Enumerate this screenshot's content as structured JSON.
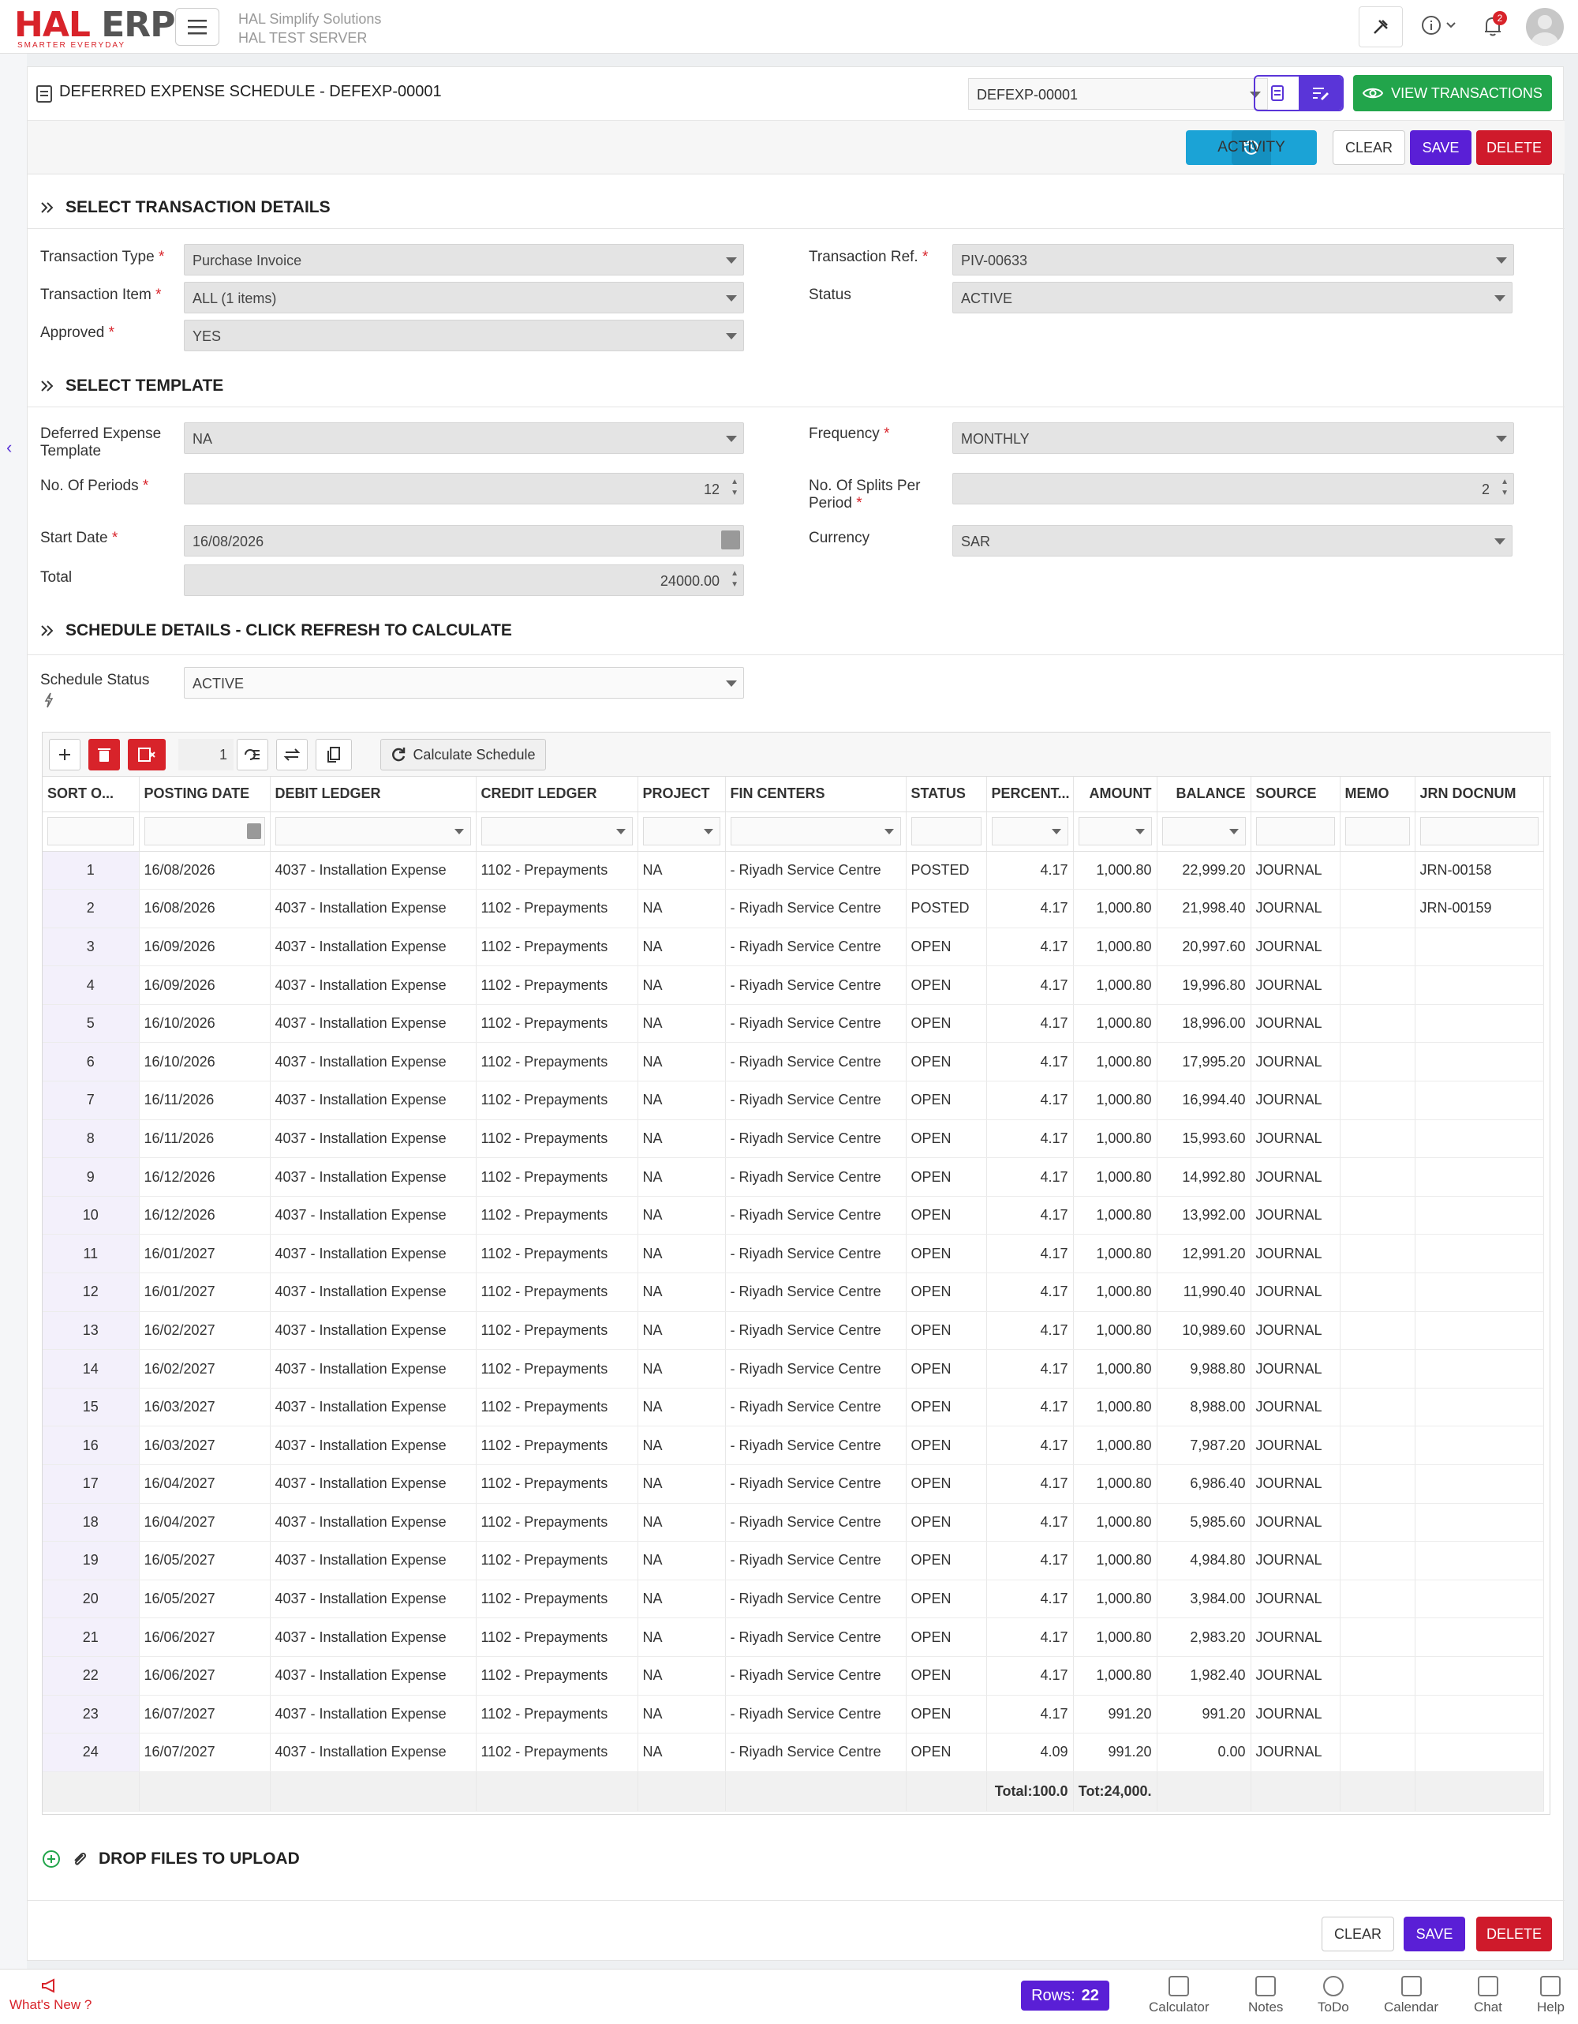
{
  "app": {
    "logo_hal": "HAL",
    "logo_erp": "ERP",
    "logo_tagline": "SMARTER EVERYDAY",
    "company_name": "HAL Simplify Solutions",
    "server_name": "HAL TEST SERVER",
    "notification_count": "2"
  },
  "header": {
    "title": "DEFERRED EXPENSE SCHEDULE - DEFEXP-00001",
    "doc_select_value": "DEFEXP-00001",
    "view_transactions_label": "VIEW TRANSACTIONS"
  },
  "actions": {
    "activity_label": "ACTIVITY",
    "clear_label": "CLEAR",
    "save_label": "SAVE",
    "delete_label": "DELETE"
  },
  "sections": {
    "transaction_details": "SELECT TRANSACTION DETAILS",
    "template": "SELECT TEMPLATE",
    "schedule_details": "SCHEDULE DETAILS - CLICK REFRESH TO CALCULATE",
    "upload": "DROP FILES TO UPLOAD"
  },
  "form": {
    "transaction_type": {
      "label": "Transaction Type",
      "value": "Purchase Invoice"
    },
    "transaction_item": {
      "label": "Transaction Item",
      "value": "ALL (1 items)"
    },
    "approved": {
      "label": "Approved",
      "value": "YES"
    },
    "transaction_ref": {
      "label": "Transaction Ref.",
      "value": "PIV-00633"
    },
    "status": {
      "label": "Status",
      "value": "ACTIVE"
    },
    "deferred_template": {
      "label": "Deferred Expense Template",
      "value": "NA"
    },
    "no_of_periods": {
      "label": "No. Of Periods",
      "value": "12"
    },
    "start_date": {
      "label": "Start Date",
      "value": "16/08/2026"
    },
    "total": {
      "label": "Total",
      "value": "24000.00"
    },
    "frequency": {
      "label": "Frequency",
      "value": "MONTHLY"
    },
    "splits_per_period": {
      "label": "No. Of Splits Per Period",
      "value": "2"
    },
    "currency": {
      "label": "Currency",
      "value": "SAR"
    },
    "schedule_status": {
      "label": "Schedule Status",
      "value": "ACTIVE"
    }
  },
  "grid": {
    "page_size": "1",
    "calculate_label": "Calculate Schedule",
    "columns": [
      "SORT O...",
      "POSTING DATE",
      "DEBIT LEDGER",
      "CREDIT LEDGER",
      "PROJECT",
      "FIN CENTERS",
      "STATUS",
      "PERCENT...",
      "AMOUNT",
      "BALANCE",
      "SOURCE",
      "MEMO",
      "JRN DOCNUM"
    ],
    "rows": [
      [
        "1",
        "16/08/2026",
        "4037 - Installation Expense",
        "1102 - Prepayments",
        "NA",
        "- Riyadh Service Centre",
        "POSTED",
        "4.17",
        "1,000.80",
        "22,999.20",
        "JOURNAL",
        "",
        "JRN-00158"
      ],
      [
        "2",
        "16/08/2026",
        "4037 - Installation Expense",
        "1102 - Prepayments",
        "NA",
        "- Riyadh Service Centre",
        "POSTED",
        "4.17",
        "1,000.80",
        "21,998.40",
        "JOURNAL",
        "",
        "JRN-00159"
      ],
      [
        "3",
        "16/09/2026",
        "4037 - Installation Expense",
        "1102 - Prepayments",
        "NA",
        "- Riyadh Service Centre",
        "OPEN",
        "4.17",
        "1,000.80",
        "20,997.60",
        "JOURNAL",
        "",
        ""
      ],
      [
        "4",
        "16/09/2026",
        "4037 - Installation Expense",
        "1102 - Prepayments",
        "NA",
        "- Riyadh Service Centre",
        "OPEN",
        "4.17",
        "1,000.80",
        "19,996.80",
        "JOURNAL",
        "",
        ""
      ],
      [
        "5",
        "16/10/2026",
        "4037 - Installation Expense",
        "1102 - Prepayments",
        "NA",
        "- Riyadh Service Centre",
        "OPEN",
        "4.17",
        "1,000.80",
        "18,996.00",
        "JOURNAL",
        "",
        ""
      ],
      [
        "6",
        "16/10/2026",
        "4037 - Installation Expense",
        "1102 - Prepayments",
        "NA",
        "- Riyadh Service Centre",
        "OPEN",
        "4.17",
        "1,000.80",
        "17,995.20",
        "JOURNAL",
        "",
        ""
      ],
      [
        "7",
        "16/11/2026",
        "4037 - Installation Expense",
        "1102 - Prepayments",
        "NA",
        "- Riyadh Service Centre",
        "OPEN",
        "4.17",
        "1,000.80",
        "16,994.40",
        "JOURNAL",
        "",
        ""
      ],
      [
        "8",
        "16/11/2026",
        "4037 - Installation Expense",
        "1102 - Prepayments",
        "NA",
        "- Riyadh Service Centre",
        "OPEN",
        "4.17",
        "1,000.80",
        "15,993.60",
        "JOURNAL",
        "",
        ""
      ],
      [
        "9",
        "16/12/2026",
        "4037 - Installation Expense",
        "1102 - Prepayments",
        "NA",
        "- Riyadh Service Centre",
        "OPEN",
        "4.17",
        "1,000.80",
        "14,992.80",
        "JOURNAL",
        "",
        ""
      ],
      [
        "10",
        "16/12/2026",
        "4037 - Installation Expense",
        "1102 - Prepayments",
        "NA",
        "- Riyadh Service Centre",
        "OPEN",
        "4.17",
        "1,000.80",
        "13,992.00",
        "JOURNAL",
        "",
        ""
      ],
      [
        "11",
        "16/01/2027",
        "4037 - Installation Expense",
        "1102 - Prepayments",
        "NA",
        "- Riyadh Service Centre",
        "OPEN",
        "4.17",
        "1,000.80",
        "12,991.20",
        "JOURNAL",
        "",
        ""
      ],
      [
        "12",
        "16/01/2027",
        "4037 - Installation Expense",
        "1102 - Prepayments",
        "NA",
        "- Riyadh Service Centre",
        "OPEN",
        "4.17",
        "1,000.80",
        "11,990.40",
        "JOURNAL",
        "",
        ""
      ],
      [
        "13",
        "16/02/2027",
        "4037 - Installation Expense",
        "1102 - Prepayments",
        "NA",
        "- Riyadh Service Centre",
        "OPEN",
        "4.17",
        "1,000.80",
        "10,989.60",
        "JOURNAL",
        "",
        ""
      ],
      [
        "14",
        "16/02/2027",
        "4037 - Installation Expense",
        "1102 - Prepayments",
        "NA",
        "- Riyadh Service Centre",
        "OPEN",
        "4.17",
        "1,000.80",
        "9,988.80",
        "JOURNAL",
        "",
        ""
      ],
      [
        "15",
        "16/03/2027",
        "4037 - Installation Expense",
        "1102 - Prepayments",
        "NA",
        "- Riyadh Service Centre",
        "OPEN",
        "4.17",
        "1,000.80",
        "8,988.00",
        "JOURNAL",
        "",
        ""
      ],
      [
        "16",
        "16/03/2027",
        "4037 - Installation Expense",
        "1102 - Prepayments",
        "NA",
        "- Riyadh Service Centre",
        "OPEN",
        "4.17",
        "1,000.80",
        "7,987.20",
        "JOURNAL",
        "",
        ""
      ],
      [
        "17",
        "16/04/2027",
        "4037 - Installation Expense",
        "1102 - Prepayments",
        "NA",
        "- Riyadh Service Centre",
        "OPEN",
        "4.17",
        "1,000.80",
        "6,986.40",
        "JOURNAL",
        "",
        ""
      ],
      [
        "18",
        "16/04/2027",
        "4037 - Installation Expense",
        "1102 - Prepayments",
        "NA",
        "- Riyadh Service Centre",
        "OPEN",
        "4.17",
        "1,000.80",
        "5,985.60",
        "JOURNAL",
        "",
        ""
      ],
      [
        "19",
        "16/05/2027",
        "4037 - Installation Expense",
        "1102 - Prepayments",
        "NA",
        "- Riyadh Service Centre",
        "OPEN",
        "4.17",
        "1,000.80",
        "4,984.80",
        "JOURNAL",
        "",
        ""
      ],
      [
        "20",
        "16/05/2027",
        "4037 - Installation Expense",
        "1102 - Prepayments",
        "NA",
        "- Riyadh Service Centre",
        "OPEN",
        "4.17",
        "1,000.80",
        "3,984.00",
        "JOURNAL",
        "",
        ""
      ],
      [
        "21",
        "16/06/2027",
        "4037 - Installation Expense",
        "1102 - Prepayments",
        "NA",
        "- Riyadh Service Centre",
        "OPEN",
        "4.17",
        "1,000.80",
        "2,983.20",
        "JOURNAL",
        "",
        ""
      ],
      [
        "22",
        "16/06/2027",
        "4037 - Installation Expense",
        "1102 - Prepayments",
        "NA",
        "- Riyadh Service Centre",
        "OPEN",
        "4.17",
        "1,000.80",
        "1,982.40",
        "JOURNAL",
        "",
        ""
      ],
      [
        "23",
        "16/07/2027",
        "4037 - Installation Expense",
        "1102 - Prepayments",
        "NA",
        "- Riyadh Service Centre",
        "OPEN",
        "4.17",
        "991.20",
        "991.20",
        "JOURNAL",
        "",
        ""
      ],
      [
        "24",
        "16/07/2027",
        "4037 - Installation Expense",
        "1102 - Prepayments",
        "NA",
        "- Riyadh Service Centre",
        "OPEN",
        "4.09",
        "991.20",
        "0.00",
        "JOURNAL",
        "",
        ""
      ]
    ],
    "footer_percent": "Total:100.0",
    "footer_amount": "Tot:24,000."
  },
  "footer": {
    "whats_new": "What's New ?",
    "rows_label": "Rows:",
    "rows_count": "22",
    "items": [
      "Calculator",
      "Notes",
      "ToDo",
      "Calendar",
      "Chat",
      "Help"
    ]
  },
  "colors": {
    "brand_red": "#d8232a",
    "primary_purple": "#5a1fd6",
    "success_green": "#22a54b",
    "activity_blue": "#1ba3d6"
  },
  "icons": {
    "menu": "hamburger-icon",
    "tools": "tools-icon",
    "info": "info-icon",
    "notifications": "bell-icon",
    "view": "eye-icon",
    "activity": "history-icon",
    "section": "double-chevron-icon",
    "attach": "paperclip-icon"
  }
}
